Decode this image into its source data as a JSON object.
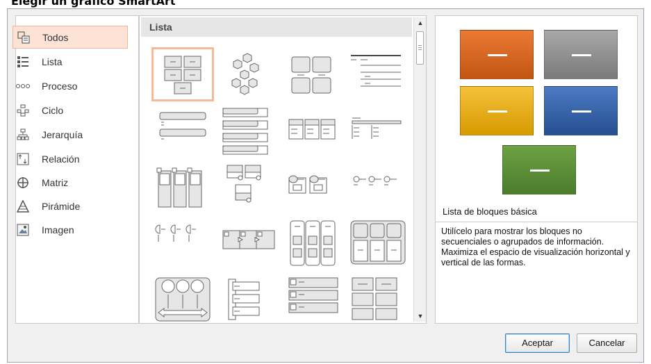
{
  "window": {
    "title": "Elegir un gráfico SmartArt"
  },
  "categories": {
    "items": [
      {
        "label": "Todos",
        "icon": "all-icon",
        "selected": true
      },
      {
        "label": "Lista",
        "icon": "list-icon"
      },
      {
        "label": "Proceso",
        "icon": "process-icon"
      },
      {
        "label": "Ciclo",
        "icon": "cycle-icon"
      },
      {
        "label": "Jerarquía",
        "icon": "hierarchy-icon"
      },
      {
        "label": "Relación",
        "icon": "relationship-icon"
      },
      {
        "label": "Matriz",
        "icon": "matrix-icon"
      },
      {
        "label": "Pirámide",
        "icon": "pyramid-icon"
      },
      {
        "label": "Imagen",
        "icon": "picture-icon"
      }
    ]
  },
  "gallery": {
    "header": "Lista",
    "selected_index": 0,
    "layouts": [
      "block-list",
      "hexagon-cluster",
      "grouped-list",
      "lined-list",
      "vertical-bullet-list",
      "vertical-box-list",
      "horizontal-bullet-list",
      "table-list",
      "stacked-list",
      "detailed-list",
      "picture-caption-list",
      "horizontal-picture-list",
      "pie-process-list",
      "bending-picture-blocks",
      "vertical-curved-list",
      "segmented-list",
      "circle-arrow-list",
      "vertical-accent-list",
      "picture-lineup",
      "tiled-list"
    ]
  },
  "preview": {
    "colors": {
      "orange": "#d2651f",
      "gray": "#8a8a8a",
      "gold": "#e3a80f",
      "blue": "#2f5c9e",
      "green": "#5a8a37"
    },
    "layout_name": "Lista de bloques básica",
    "description": "Utilícelo para mostrar los bloques no secuenciales o agrupados de información. Maximiza el espacio de visualización horizontal y vertical de las formas."
  },
  "buttons": {
    "ok": "Aceptar",
    "cancel": "Cancelar"
  }
}
